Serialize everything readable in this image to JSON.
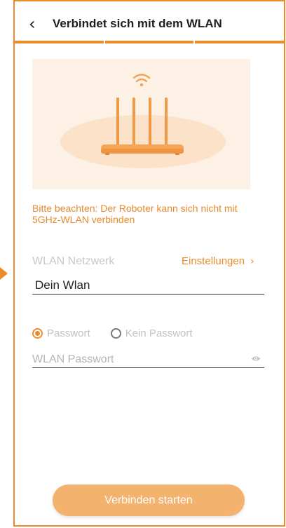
{
  "header": {
    "back_icon": "chevron-left-icon",
    "title": "Verbindet sich mit dem WLAN",
    "progress_segments": 3,
    "accent_color": "#e98d2b"
  },
  "illustration": {
    "icon": "router-wifi-illustration"
  },
  "notice": "Bitte beachten: Der Roboter kann sich nicht mit 5GHz-WLAN verbinden",
  "network": {
    "label": "WLAN Netzwerk",
    "settings_label": "Einstellungen",
    "settings_icon": "chevron-right-icon",
    "ssid_value": "Dein Wlan"
  },
  "auth": {
    "options": [
      {
        "label": "Passwort",
        "selected": true
      },
      {
        "label": "Kein Passwort",
        "selected": false
      }
    ],
    "password_placeholder": "WLAN Passwort",
    "toggle_icon": "eye-icon"
  },
  "cta_label": "Verbinden starten"
}
